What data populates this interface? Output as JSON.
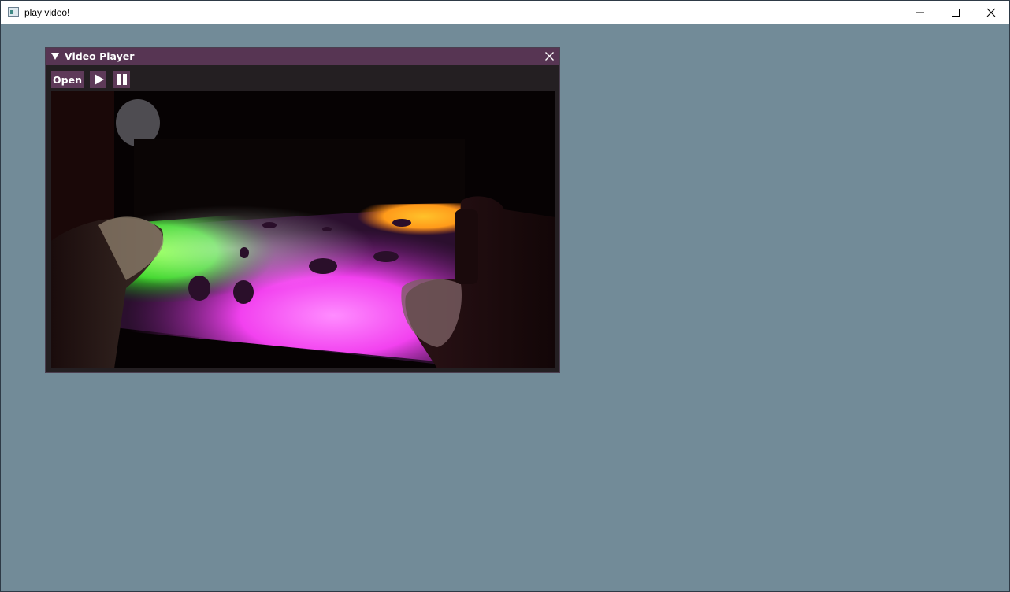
{
  "os_window": {
    "title": "play video!",
    "icon": "app-window-icon",
    "controls": [
      "minimize-icon",
      "maximize-icon",
      "close-icon"
    ]
  },
  "player": {
    "title": "Video Player",
    "collapse_icon": "triangle-down-icon",
    "close_icon": "close-icon",
    "buttons": {
      "open_label": "Open",
      "play_icon": "play-icon",
      "pause_icon": "pause-icon"
    },
    "video": {
      "content": "video-frame"
    }
  },
  "colors": {
    "desktop_background": "#728b98",
    "panel_title_bar": "#573553",
    "panel_background": "#241f22",
    "button": "#5e3a59"
  }
}
